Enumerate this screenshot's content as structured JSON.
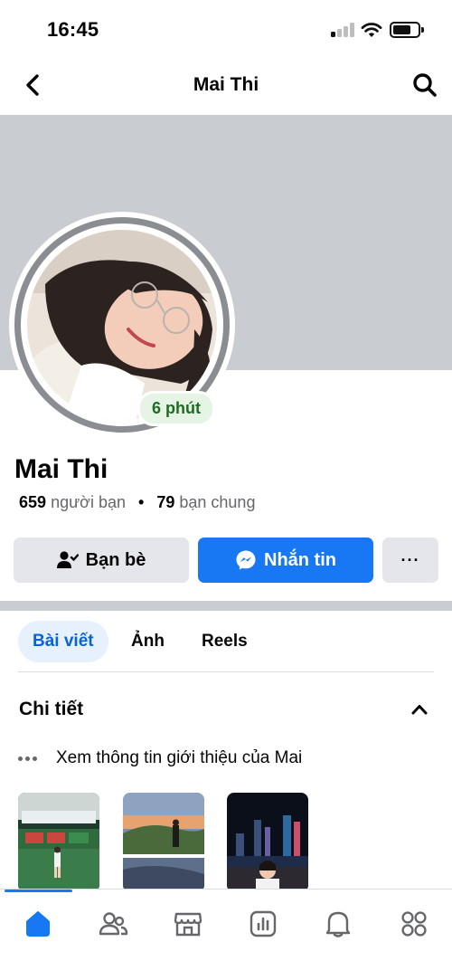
{
  "status_bar": {
    "time": "16:45"
  },
  "header": {
    "title": "Mai Thi"
  },
  "profile": {
    "name": "Mai Thi",
    "active_badge": "6 phút",
    "friends_count": "659",
    "friends_label": "người bạn",
    "separator": "•",
    "mutual_count": "79",
    "mutual_label": "bạn chung"
  },
  "actions": {
    "friends_label": "Bạn bè",
    "message_label": "Nhắn tin",
    "more_label": "···"
  },
  "tabs": [
    {
      "label": "Bài viết",
      "active": true
    },
    {
      "label": "Ảnh",
      "active": false
    },
    {
      "label": "Reels",
      "active": false
    }
  ],
  "details": {
    "title": "Chi tiết",
    "about_text": "Xem thông tin giới thiệu của Mai"
  },
  "colors": {
    "accent": "#1877f2",
    "active_badge_text": "#1e6b22",
    "cover": "#c9ccd1"
  },
  "bottom_nav": [
    {
      "icon": "home-icon",
      "active": true
    },
    {
      "icon": "friends-icon",
      "active": false
    },
    {
      "icon": "marketplace-icon",
      "active": false
    },
    {
      "icon": "dashboard-icon",
      "active": false
    },
    {
      "icon": "bell-icon",
      "active": false
    },
    {
      "icon": "menu-grid-icon",
      "active": false
    }
  ]
}
